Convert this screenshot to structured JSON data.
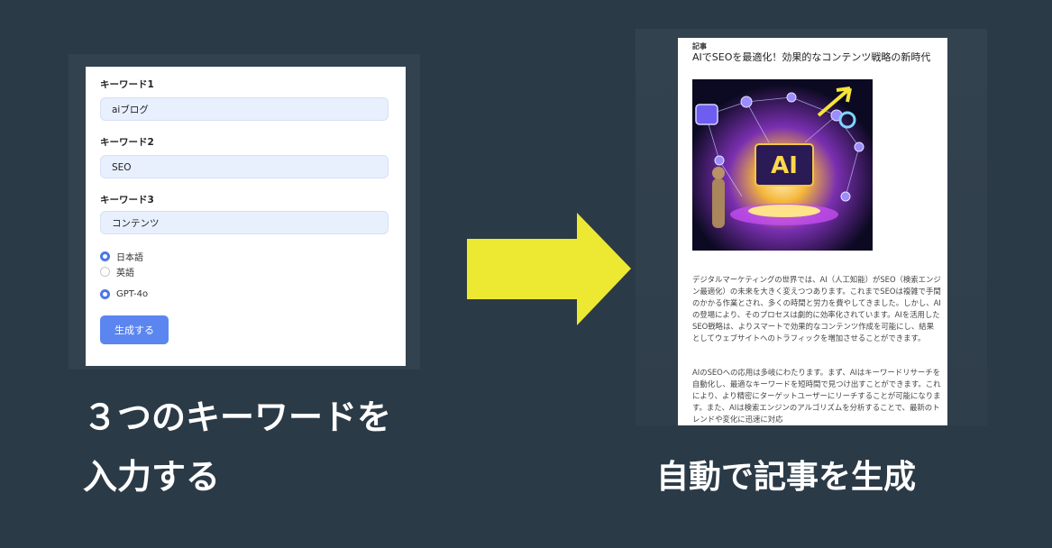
{
  "form": {
    "fields": [
      {
        "label": "キーワード1",
        "value": "aiブログ"
      },
      {
        "label": "キーワード2",
        "value": "SEO"
      },
      {
        "label": "キーワード3",
        "value": "コンテンツ"
      }
    ],
    "language_options": [
      {
        "label": "日本語",
        "checked": true
      },
      {
        "label": "英語",
        "checked": false
      }
    ],
    "model_option": {
      "label": "GPT-4o",
      "checked": true
    },
    "generate_button": "生成する"
  },
  "left_caption": {
    "line1": "３つのキーワードを",
    "line2": "入力する"
  },
  "right_caption": "自動で記事を生成",
  "article": {
    "category": "記事",
    "title": "AIでSEOを最適化！効果的なコンテンツ戦略の新時代",
    "image_text": "AI",
    "paragraph1": "デジタルマーケティングの世界では、AI（人工知能）がSEO（検索エンジン最適化）の未来を大きく変えつつあります。これまでSEOは複雑で手間のかかる作業とされ、多くの時間と労力を費やしてきました。しかし、AIの登場により、そのプロセスは劇的に効率化されています。AIを活用したSEO戦略は、よりスマートで効果的なコンテンツ作成を可能にし、結果としてウェブサイトへのトラフィックを増加させることができます。",
    "paragraph2": "AIのSEOへの応用は多岐にわたります。まず、AIはキーワードリサーチを自動化し、最適なキーワードを短時間で見つけ出すことができます。これにより、より精密にターゲットユーザーにリーチすることが可能になります。また、AIは検索エンジンのアルゴリズムを分析することで、最新のトレンドや変化に迅速に対応"
  },
  "colors": {
    "background": "#2b3a47",
    "arrow": "#ede832",
    "button": "#5b86f0",
    "input_bg": "#e8f0fe"
  }
}
